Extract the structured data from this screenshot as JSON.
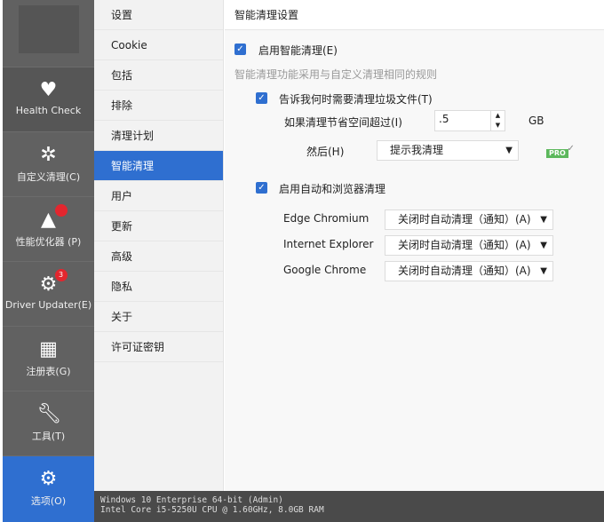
{
  "sidebar": {
    "items": [
      {
        "label": "Health Check",
        "icon": "heart-check-icon"
      },
      {
        "label": "自定义清理(C)",
        "icon": "broom-icon"
      },
      {
        "label": "性能优化器 (P)",
        "icon": "rocket-icon"
      },
      {
        "label": "Driver Updater(E)",
        "icon": "gear-refresh-icon",
        "badge": "3"
      },
      {
        "label": "注册表(G)",
        "icon": "grid-icon"
      },
      {
        "label": "工具(T)",
        "icon": "wrench-icon"
      },
      {
        "label": "选项(O)",
        "icon": "gear-icon"
      }
    ]
  },
  "menu": {
    "items": [
      "设置",
      "Cookie",
      "包括",
      "排除",
      "清理计划",
      "智能清理",
      "用户",
      "更新",
      "高级",
      "隐私",
      "关于",
      "许可证密钥"
    ]
  },
  "main": {
    "title": "智能清理设置",
    "enable_label": "启用智能清理(E)",
    "description": "智能清理功能采用与自定义清理相同的规则",
    "notify_label": "告诉我何时需要清理垃圾文件(T)",
    "threshold_label": "如果清理节省空间超过(I)",
    "threshold_value": ".5",
    "unit": "GB",
    "pro": "PRO",
    "then_label": "然后(H)",
    "then_value": "提示我清理",
    "auto_label": "启用自动和浏览器清理",
    "browsers": [
      {
        "name": "Edge Chromium",
        "value": "关闭时自动清理（通知）(A)"
      },
      {
        "name": "Internet Explorer",
        "value": "关闭时自动清理（通知）(A)"
      },
      {
        "name": "Google Chrome",
        "value": "关闭时自动清理（通知）(A)"
      }
    ]
  },
  "status": {
    "line1": "Windows 10 Enterprise 64-bit (Admin)",
    "line2": "Intel Core i5-5250U CPU @ 1.60GHz, 8.0GB RAM"
  },
  "colors": {
    "accent": "#2f6fd0",
    "sidebar": "#616161",
    "pro": "#5cb85c",
    "badge": "#e3262e"
  }
}
